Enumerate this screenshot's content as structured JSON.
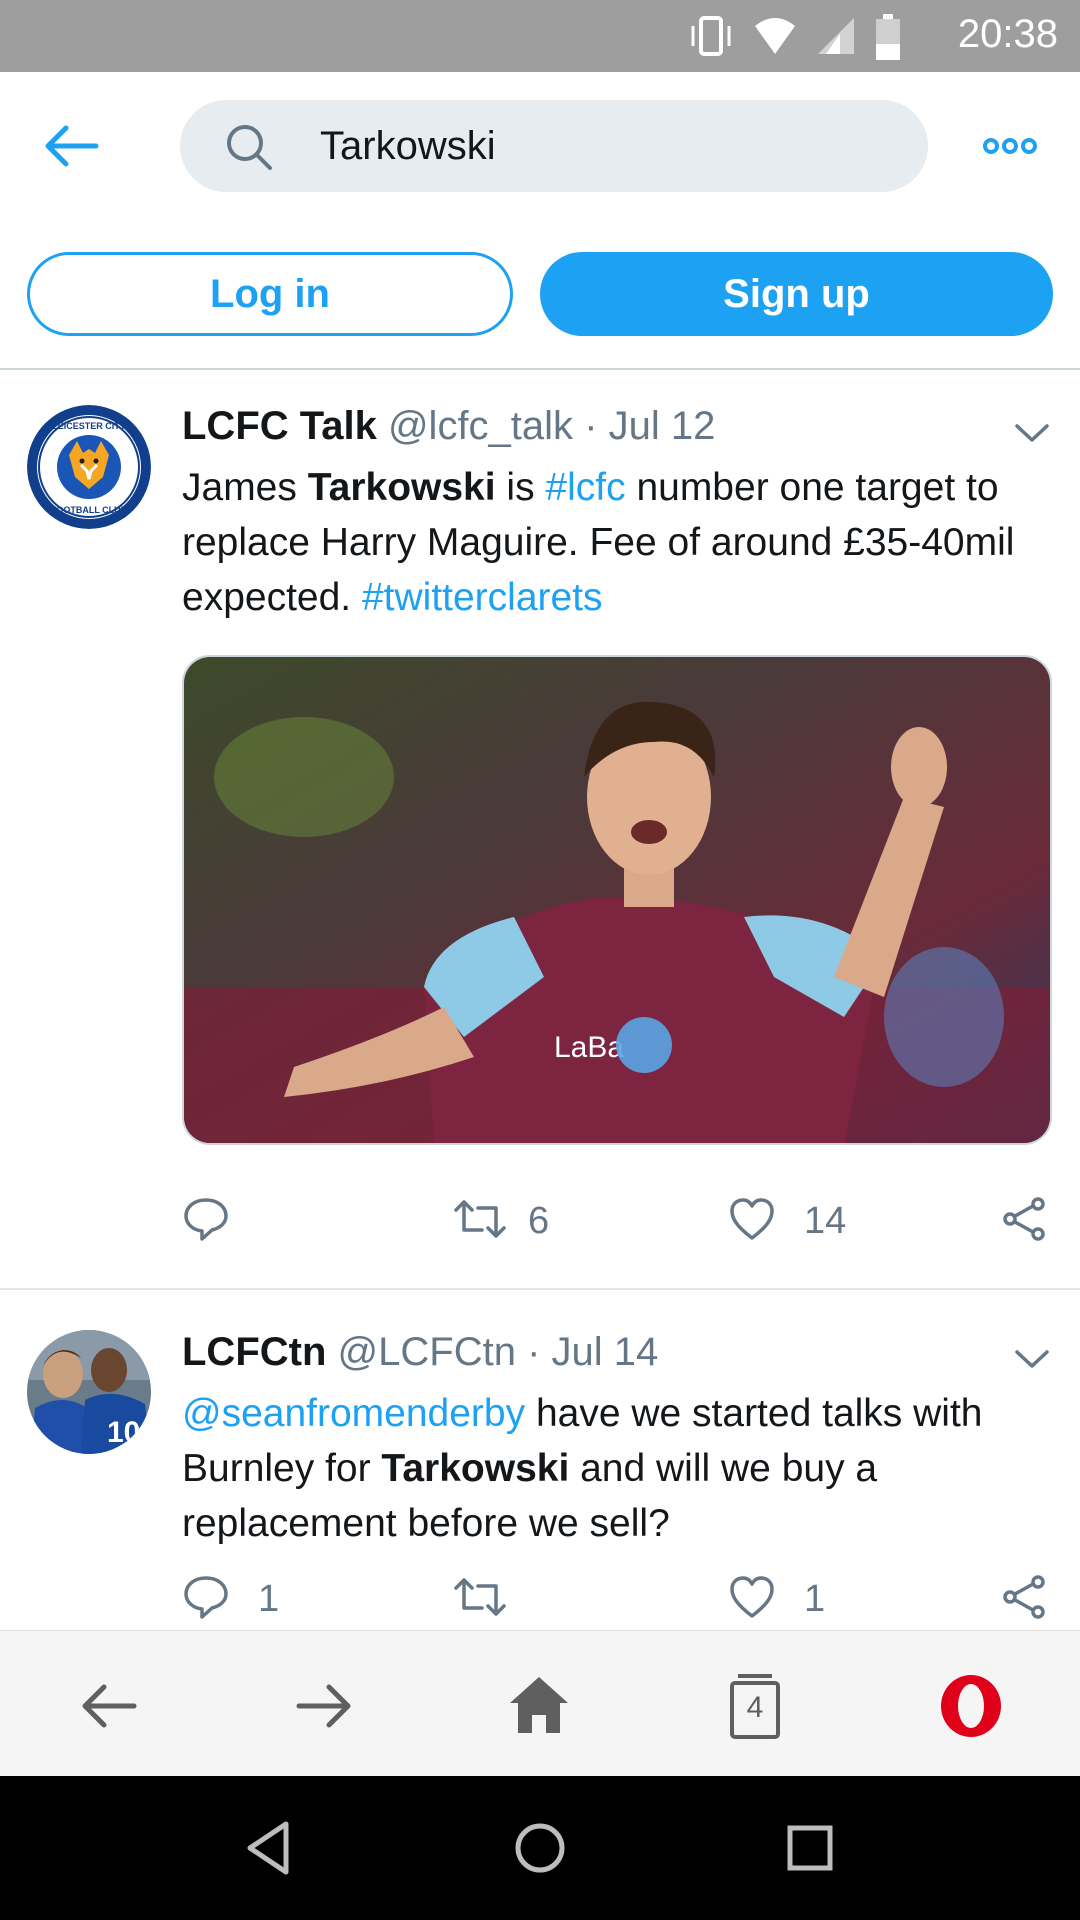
{
  "status_bar": {
    "time": "20:38",
    "icons": [
      "vibrate-icon",
      "wifi-icon",
      "signal-icon",
      "battery-icon"
    ]
  },
  "top_bar": {
    "search_value": "Tarkowski",
    "icons": [
      "back-arrow-icon",
      "search-icon",
      "more-icon"
    ]
  },
  "auth": {
    "login_label": "Log in",
    "signup_label": "Sign up"
  },
  "tweets": [
    {
      "name": "LCFC Talk",
      "handle": "@lcfc_talk",
      "dot": "·",
      "date": "Jul 12",
      "text": {
        "p1": "James ",
        "bold1": "Tarkowski",
        "p2": " is ",
        "link1": "#lcfc",
        "p3": " number one target to replace Harry Maguire. Fee of around £35-40mil expected. ",
        "link2": "#twitterclarets"
      },
      "media_alt": "Footballer in claret and blue kit pointing",
      "media_text": "LaBa",
      "reply_count": "",
      "retweet_count": "6",
      "like_count": "14"
    },
    {
      "name": "LCFCtn",
      "handle": "@LCFCtn",
      "dot": "·",
      "date": "Jul 14",
      "text": {
        "link1": "@seanfromenderby",
        "p1": " have we started talks with Burnley for ",
        "bold1": "Tarkowski",
        "p2": " and will we buy a replacement before we sell?"
      },
      "reply_count": "1",
      "retweet_count": "",
      "like_count": "1"
    }
  ],
  "browser_bar": {
    "tab_count": "4",
    "icons": [
      "back-icon",
      "forward-icon",
      "home-icon",
      "tabs-icon",
      "opera-icon"
    ]
  },
  "colors": {
    "accent": "#1da1f2",
    "secondary_text": "#657786",
    "status_bar": "#9e9e9e"
  }
}
